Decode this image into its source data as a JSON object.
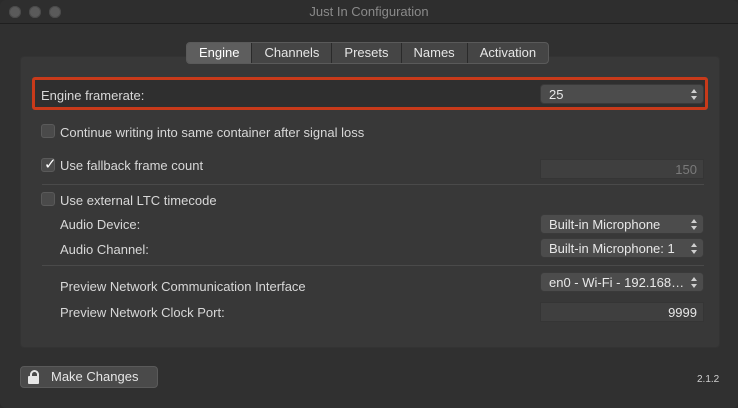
{
  "window": {
    "title": "Just In Configuration"
  },
  "tabs": [
    "Engine",
    "Channels",
    "Presets",
    "Names",
    "Activation"
  ],
  "engine": {
    "framerate_label": "Engine framerate:",
    "framerate_value": "25",
    "continue_writing_label": "Continue writing into same container after signal loss",
    "continue_writing_checked": false,
    "fallback_label": "Use fallback frame count",
    "fallback_checked": true,
    "fallback_value": "150",
    "ltc_label": "Use external LTC timecode",
    "ltc_checked": false,
    "audio_device_label": "Audio Device:",
    "audio_device_value": "Built-in Microphone",
    "audio_channel_label": "Audio Channel:",
    "audio_channel_value": "Built-in Microphone: 1",
    "preview_interface_label": "Preview Network Communication Interface",
    "preview_interface_value": "en0 - Wi-Fi - 192.168…",
    "preview_port_label": "Preview Network Clock Port:",
    "preview_port_value": "9999"
  },
  "footer": {
    "make_changes": "Make Changes",
    "version": "2.1.2"
  },
  "colors": {
    "highlight": "#c83a1a"
  }
}
